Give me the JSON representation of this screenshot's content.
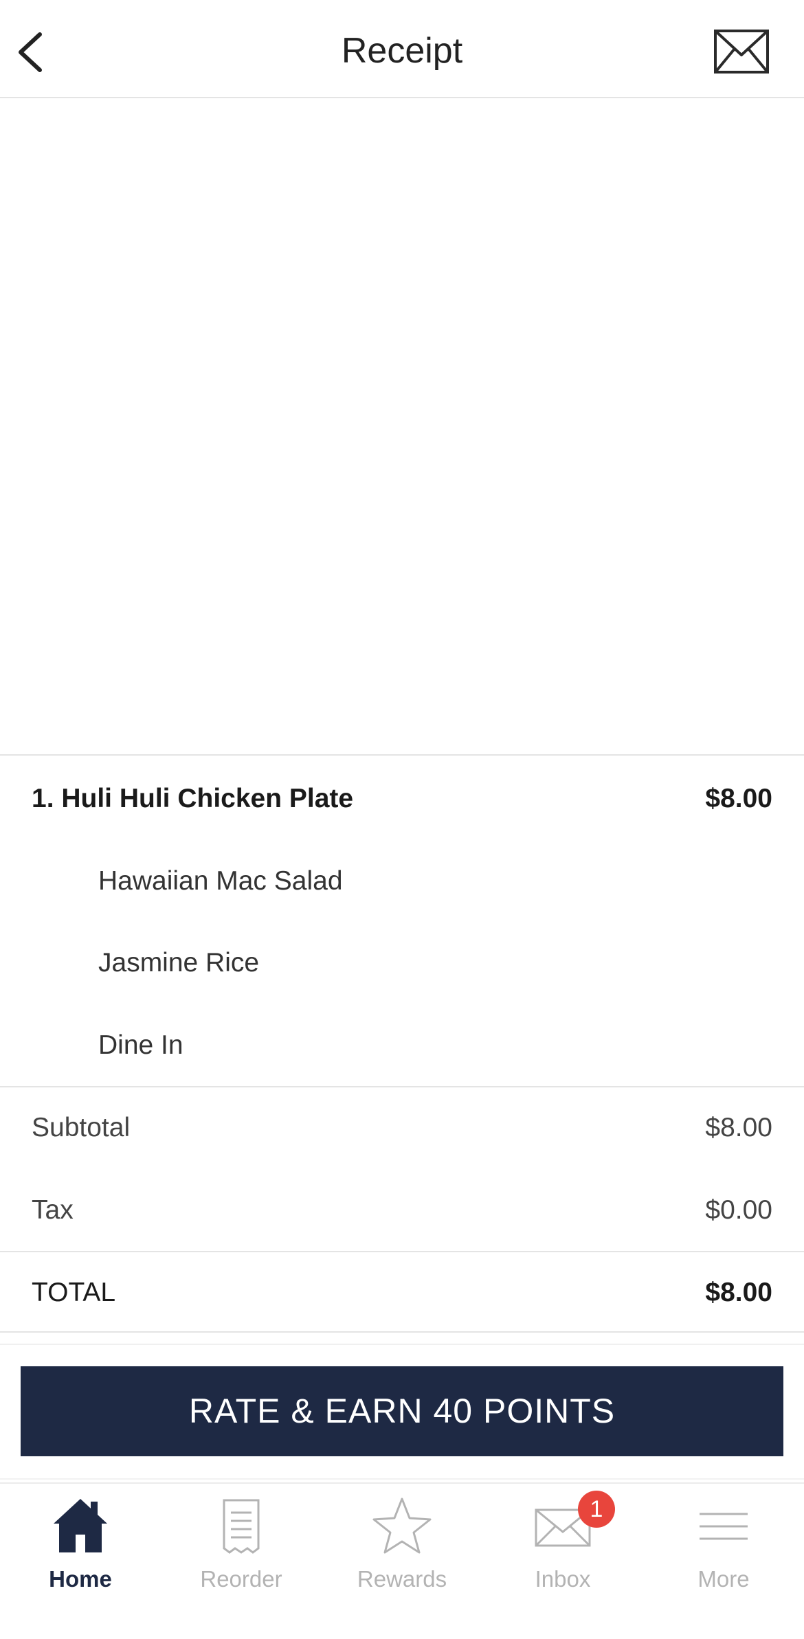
{
  "header": {
    "title": "Receipt",
    "back_icon": "chevron-left-icon",
    "email_icon": "envelope-icon"
  },
  "order": {
    "items": [
      {
        "name": "1. Huli Huli Chicken Plate",
        "price": "$8.00",
        "modifiers": [
          "Hawaiian Mac Salad",
          "Jasmine Rice",
          "Dine In"
        ]
      }
    ]
  },
  "summary": {
    "subtotal_label": "Subtotal",
    "subtotal_value": "$8.00",
    "tax_label": "Tax",
    "tax_value": "$0.00",
    "total_label": "TOTAL",
    "total_value": "$8.00"
  },
  "cta": {
    "label": "RATE & EARN 40 POINTS"
  },
  "tabbar": {
    "tabs": [
      {
        "label": "Home",
        "icon": "home-icon",
        "active": true
      },
      {
        "label": "Reorder",
        "icon": "receipt-icon",
        "active": false
      },
      {
        "label": "Rewards",
        "icon": "star-icon",
        "active": false
      },
      {
        "label": "Inbox",
        "icon": "envelope-icon",
        "active": false
      },
      {
        "label": "More",
        "icon": "menu-icon",
        "active": false
      }
    ],
    "inbox_badge": "1"
  },
  "colors": {
    "navy": "#1e2944",
    "badge": "#e8453c",
    "inactive": "#b3b3b3"
  }
}
